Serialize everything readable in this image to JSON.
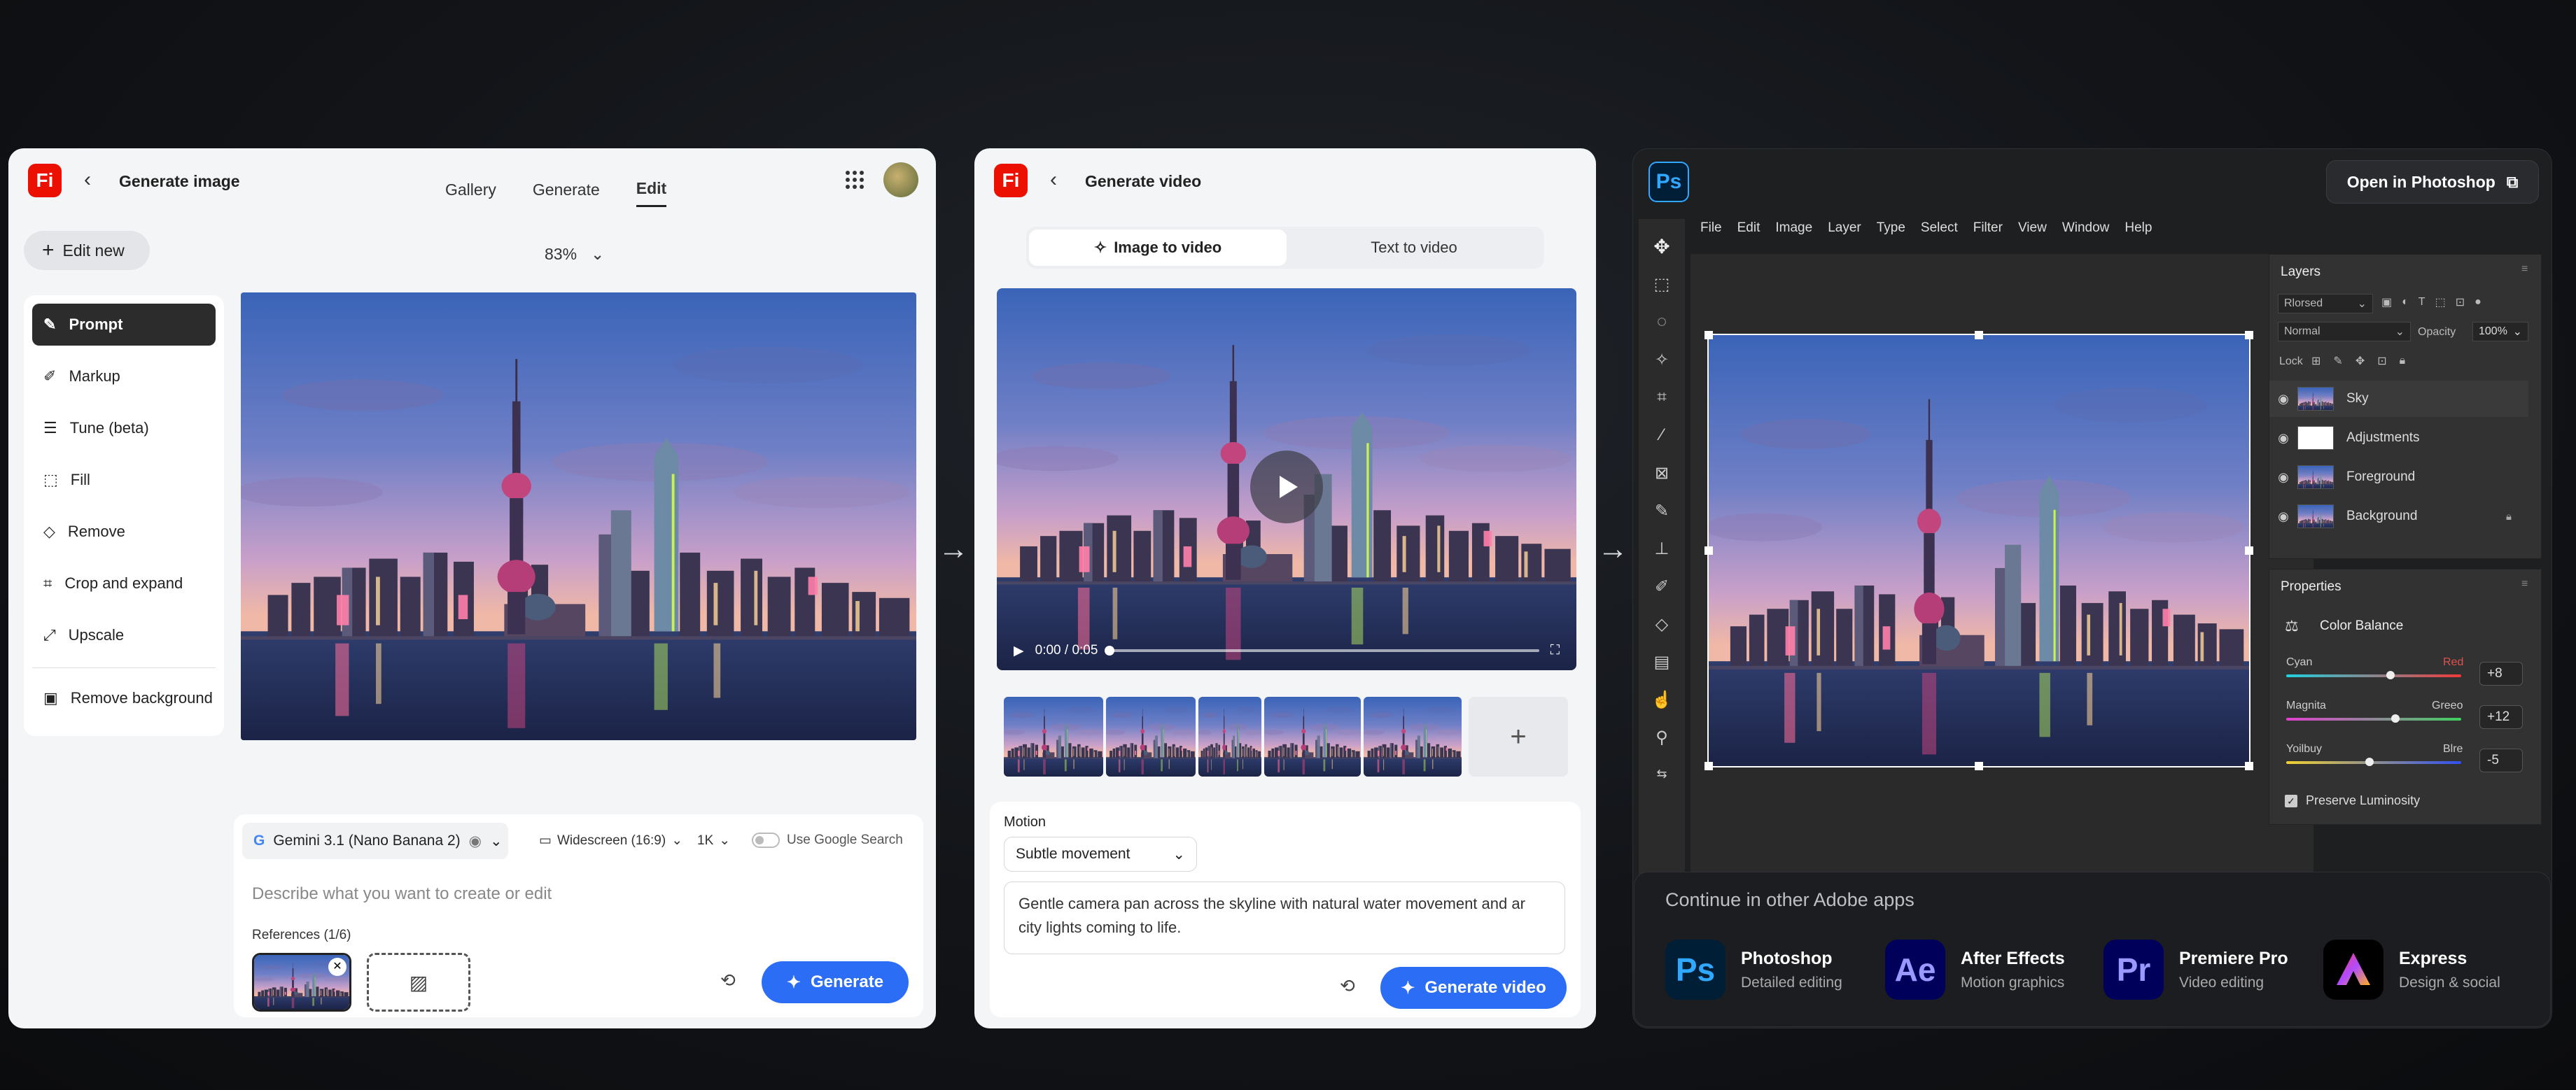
{
  "colors": {
    "adobe_red": "#eb1000",
    "primary_blue": "#2b6df4",
    "ps_blue": "#31a8ff",
    "ae_purple": "#9999ff",
    "pr_purple": "#9999ff",
    "swatch_magenta": "#d61f6d",
    "swatch_green": "#b3c93a"
  },
  "image_editor": {
    "title": "Generate image",
    "logo": "Fi",
    "tabs": [
      "Gallery",
      "Generate",
      "Edit"
    ],
    "active_tab": "Edit",
    "edit_new": "Edit new",
    "zoom": "83%",
    "tools": [
      "Prompt",
      "Markup",
      "Tune (beta)",
      "Fill",
      "Remove",
      "Crop and expand",
      "Upscale",
      "Remove background"
    ],
    "model": "Gemini 3.1 (Nano Banana 2)",
    "aspect": "Widescreen (16:9)",
    "resolution": "1K",
    "google_search": "Use Google Search",
    "prompt_placeholder": "Describe what you want to create or edit",
    "references": "References (1/6)",
    "generate": "Generate"
  },
  "video_editor": {
    "title": "Generate video",
    "logo": "Fi",
    "tabs": [
      "Image to video",
      "Text to video"
    ],
    "time": "0:00 / 0:05",
    "motion_label": "Motion",
    "motion_value": "Subtle movement",
    "prompt": "Gentle camera pan across the skyline with natural water movement and ar city lights coming to life.",
    "generate": "Generate video"
  },
  "photoshop": {
    "logo": "Ps",
    "open_button": "Open in Photoshop",
    "menu": [
      "File",
      "Edit",
      "Image",
      "Layer",
      "Type",
      "Select",
      "Filter",
      "View",
      "Window",
      "Help"
    ],
    "layers_title": "Layers",
    "kind_filter": "Rlorsed",
    "blend_mode": "Normal",
    "opacity_label": "Opacity",
    "opacity_value": "100%",
    "lock_label": "Lock",
    "layers": [
      "Sky",
      "Adjustments",
      "Foreground",
      "Background"
    ],
    "properties_title": "Properties",
    "adjustment": "Color Balance",
    "sliders": [
      {
        "left": "Cyan",
        "right": "Red",
        "value": "+8",
        "level": 0.57
      },
      {
        "left": "Magnita",
        "right": "Greeo",
        "value": "+12",
        "level": 0.6
      },
      {
        "left": "Yoilbuy",
        "right": "Blre",
        "value": "-5",
        "level": 0.45
      }
    ],
    "preserve": "Preserve Luminosity"
  },
  "continue": {
    "title": "Continue in other Adobe apps",
    "apps": [
      {
        "abbr": "Ps",
        "name": "Photoshop",
        "desc": "Detailed editing"
      },
      {
        "abbr": "Ae",
        "name": "After Effects",
        "desc": "Motion graphics"
      },
      {
        "abbr": "Pr",
        "name": "Premiere Pro",
        "desc": "Video editing"
      },
      {
        "abbr": "",
        "name": "Express",
        "desc": "Design & social"
      }
    ]
  }
}
